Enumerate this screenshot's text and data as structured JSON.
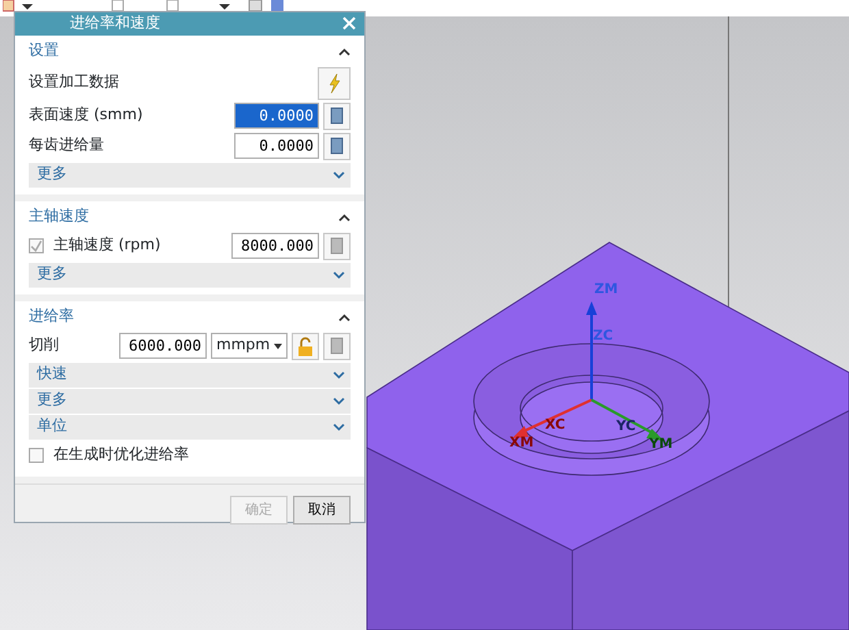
{
  "dialog": {
    "title": "进给率和速度"
  },
  "settings": {
    "title": "设置",
    "expanded": true,
    "action_label": "设置加工数据",
    "fields": [
      {
        "label": "表面速度 (smm)",
        "value": "0.0000",
        "selected": true
      },
      {
        "label": "每齿进给量",
        "value": "0.0000",
        "selected": false
      }
    ],
    "more": {
      "label": "更多",
      "expanded": false
    }
  },
  "spindle": {
    "title": "主轴速度",
    "expanded": true,
    "checkbox": {
      "label": "主轴速度 (rpm)",
      "checked": true,
      "disabled": true
    },
    "value": "8000.000",
    "more": {
      "label": "更多",
      "expanded": false
    }
  },
  "feed": {
    "title": "进给率",
    "expanded": true,
    "cut": {
      "label": "切削",
      "value": "6000.000",
      "unit": "mmpm",
      "locked": false
    },
    "groups": [
      {
        "label": "快速",
        "expanded": false
      },
      {
        "label": "更多",
        "expanded": false
      },
      {
        "label": "单位",
        "expanded": false
      }
    ],
    "optimize": {
      "label": "在生成时优化进给率",
      "checked": false
    }
  },
  "buttons": [
    {
      "label": "确定",
      "disabled": true
    },
    {
      "label": "取消",
      "disabled": false
    }
  ],
  "viewport": {
    "axis_labels": [
      {
        "text": "ZM",
        "color": "#2f56e0"
      },
      {
        "text": "ZC",
        "color": "#2f56e0"
      },
      {
        "text": "XC",
        "color": "#8a0808"
      },
      {
        "text": "YC",
        "color": "#1c2466"
      },
      {
        "text": "XM",
        "color": "#8a0808"
      },
      {
        "text": "YM",
        "color": "#0c4a0c"
      }
    ]
  }
}
